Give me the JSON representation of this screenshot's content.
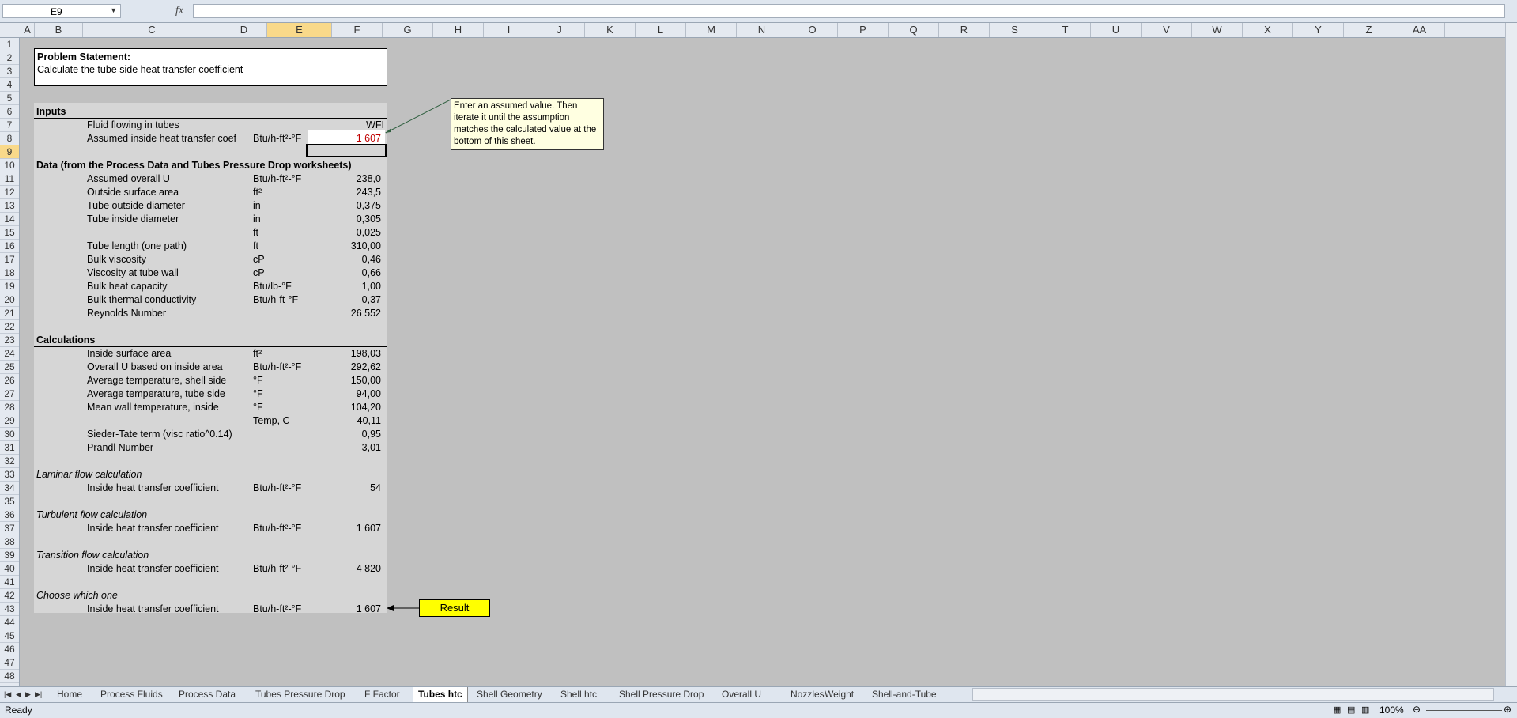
{
  "namebox": {
    "value": "E9"
  },
  "formula_bar": {
    "fx_label": "fx",
    "value": ""
  },
  "columns": [
    "A",
    "B",
    "C",
    "D",
    "E",
    "F",
    "G",
    "H",
    "I",
    "J",
    "K",
    "L",
    "M",
    "N",
    "O",
    "P",
    "Q",
    "R",
    "S",
    "T",
    "U",
    "V",
    "W",
    "X",
    "Y",
    "Z",
    "AA"
  ],
  "selected_column": "E",
  "selected_row": "9",
  "rows": [
    "1",
    "2",
    "3",
    "4",
    "5",
    "6",
    "7",
    "8",
    "9",
    "10",
    "11",
    "12",
    "13",
    "14",
    "15",
    "16",
    "17",
    "18",
    "19",
    "20",
    "21",
    "22",
    "23",
    "24",
    "25",
    "26",
    "27",
    "28",
    "29",
    "30",
    "31",
    "32",
    "33",
    "34",
    "35",
    "36",
    "37",
    "38",
    "39",
    "40",
    "41",
    "42",
    "43",
    "44",
    "45",
    "46",
    "47",
    "48"
  ],
  "problem": {
    "title": "Problem Statement:",
    "text": "Calculate the tube side heat transfer coefficient"
  },
  "inputs": {
    "header": "Inputs",
    "fluid_label": "Fluid flowing in tubes",
    "fluid_value": "WFI",
    "assumed_label": "Assumed inside heat transfer coef",
    "assumed_unit": "Btu/h-ft²-°F",
    "assumed_value": "1 607"
  },
  "data_section": {
    "header": "Data (from the Process Data and Tubes Pressure Drop worksheets)",
    "rows": [
      {
        "label": "Assumed overall U",
        "unit": "Btu/h-ft²-°F",
        "value": "238,0"
      },
      {
        "label": "Outside surface area",
        "unit": "ft²",
        "value": "243,5"
      },
      {
        "label": "Tube outside diameter",
        "unit": "in",
        "value": "0,375"
      },
      {
        "label": "Tube inside diameter",
        "unit": "in",
        "value": "0,305"
      },
      {
        "label": "",
        "unit": "ft",
        "value": "0,025"
      },
      {
        "label": "Tube length (one path)",
        "unit": "ft",
        "value": "310,00"
      },
      {
        "label": "Bulk viscosity",
        "unit": "cP",
        "value": "0,46"
      },
      {
        "label": "Viscosity at tube wall",
        "unit": "cP",
        "value": "0,66"
      },
      {
        "label": "Bulk heat capacity",
        "unit": "Btu/lb-°F",
        "value": "1,00"
      },
      {
        "label": "Bulk thermal conductivity",
        "unit": "Btu/h-ft-°F",
        "value": "0,37"
      },
      {
        "label": "Reynolds Number",
        "unit": "",
        "value": "26 552"
      }
    ]
  },
  "calc_section": {
    "header": "Calculations",
    "rows": [
      {
        "label": "Inside surface area",
        "unit": "ft²",
        "value": "198,03"
      },
      {
        "label": "Overall U based on inside area",
        "unit": "Btu/h-ft²-°F",
        "value": "292,62"
      },
      {
        "label": "Average temperature, shell side",
        "unit": "°F",
        "value": "150,00"
      },
      {
        "label": "Average temperature, tube side",
        "unit": "°F",
        "value": "94,00"
      },
      {
        "label": "Mean wall temperature, inside",
        "unit": "°F",
        "value": "104,20"
      },
      {
        "label": "",
        "unit": "Temp, C",
        "value": "40,11"
      },
      {
        "label": "Sieder-Tate term (visc ratio^0.14)",
        "unit": "",
        "value": "0,95"
      },
      {
        "label": "Prandl Number",
        "unit": "",
        "value": "3,01"
      }
    ]
  },
  "flow_blocks": [
    {
      "title": "Laminar flow calculation",
      "label": "Inside heat transfer coefficient",
      "unit": "Btu/h-ft²-°F",
      "value": "54"
    },
    {
      "title": "Turbulent flow calculation",
      "label": "Inside heat transfer coefficient",
      "unit": "Btu/h-ft²-°F",
      "value": "1 607"
    },
    {
      "title": "Transition flow calculation",
      "label": "Inside heat transfer coefficient",
      "unit": "Btu/h-ft²-°F",
      "value": "4 820"
    },
    {
      "title": "Choose which one",
      "label": "Inside heat transfer coefficient",
      "unit": "Btu/h-ft²-°F",
      "value": "1 607"
    }
  ],
  "note": {
    "text": "Enter an assumed value. Then iterate it until the assumption matches the calculated value at the bottom of this sheet."
  },
  "result_label": "Result",
  "sheet_tabs": [
    "Home",
    "Process Fluids",
    "Process Data",
    "Tubes Pressure Drop",
    "F Factor",
    "Tubes htc",
    "Shell Geometry",
    "Shell htc",
    "Shell Pressure Drop",
    "Overall U",
    "Nozzles",
    "Weight",
    "Shell-and-Tube"
  ],
  "active_tab": "Tubes htc",
  "status": {
    "ready": "Ready",
    "zoom": "100%"
  },
  "colors": {
    "selection": "#f9d98a",
    "input_text": "#c00000",
    "note_bg": "#ffffe1",
    "result_bg": "#ffff00"
  }
}
